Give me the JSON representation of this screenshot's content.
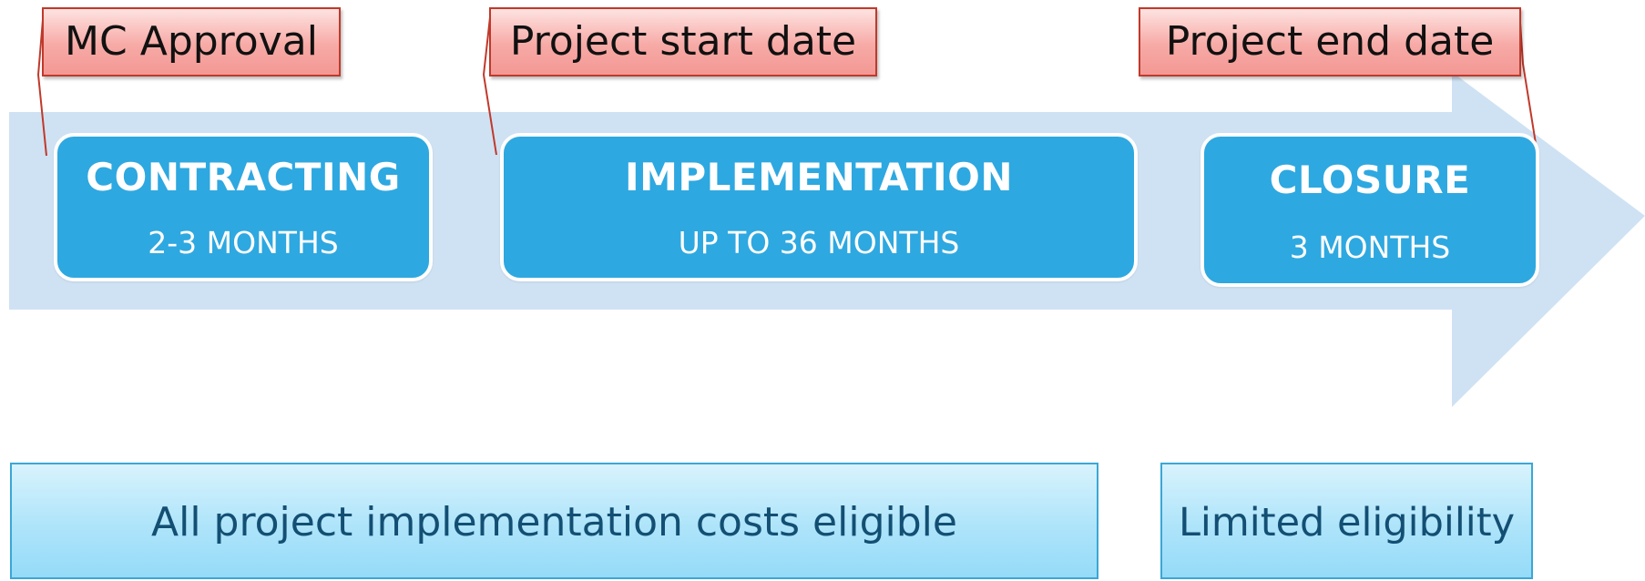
{
  "timeline": {
    "phases": [
      {
        "title": "CONTRACTING",
        "duration": "2-3 MONTHS"
      },
      {
        "title": "IMPLEMENTATION",
        "duration": "UP TO 36 MONTHS"
      },
      {
        "title": "CLOSURE",
        "duration": "3 MONTHS"
      }
    ],
    "milestones": [
      {
        "label": "MC Approval"
      },
      {
        "label": "Project start date"
      },
      {
        "label": "Project end date"
      }
    ]
  },
  "costs": [
    {
      "label": "All project implementation costs eligible"
    },
    {
      "label": "Limited eligibility"
    }
  ],
  "colors": {
    "arrow": "#cfe2f3",
    "phase_box": "#2ea8e0",
    "callout_fill": "#f7aaa6",
    "callout_border": "#c0392b",
    "cost_fill": "#aee4fa",
    "cost_text": "#134f73"
  }
}
